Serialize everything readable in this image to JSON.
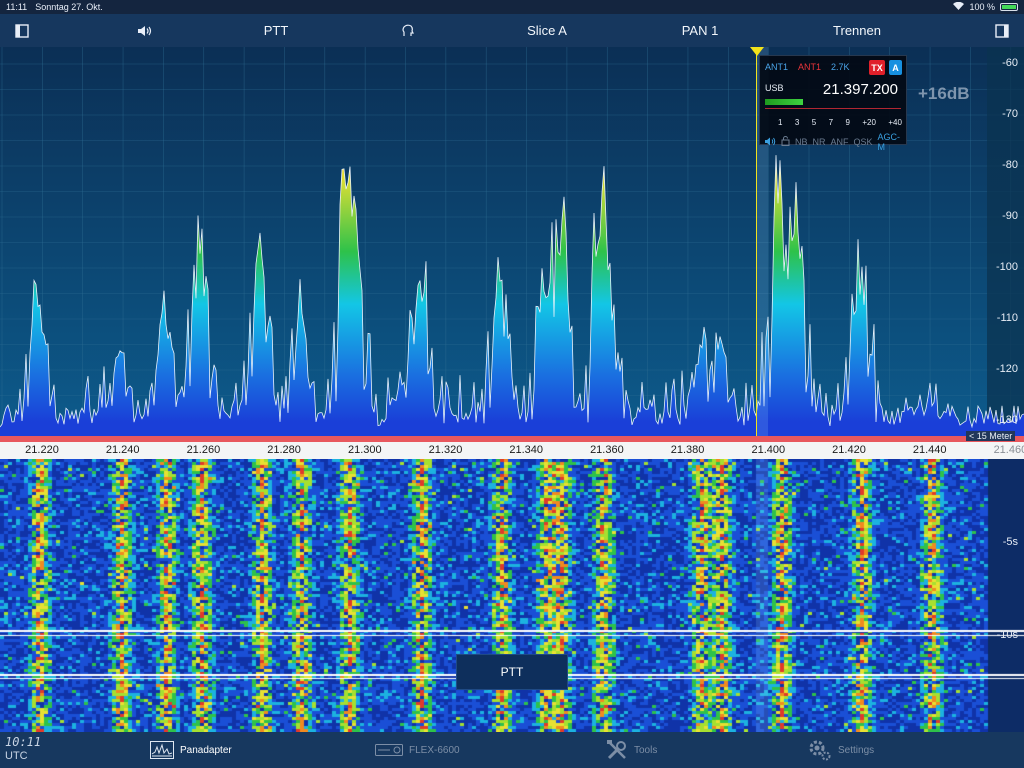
{
  "status_bar": {
    "time": "11:11",
    "date": "Sonntag 27. Okt.",
    "battery": "100 %"
  },
  "toolbar": {
    "volume_icon": "speaker-icon",
    "ptt_label": "PTT",
    "voice_icon": "head-speaking-icon",
    "slice_label": "Slice A",
    "pan_label": "PAN 1",
    "disconnect_label": "Trennen"
  },
  "panadapter": {
    "db_labels": [
      "-60",
      "-70",
      "-80",
      "-90",
      "-100",
      "-110",
      "-120",
      "-130"
    ],
    "gain_label": "+16dB",
    "band_label": "< 15 Meter",
    "freq_labels": [
      "21.220",
      "21.240",
      "21.260",
      "21.280",
      "21.300",
      "21.320",
      "21.340",
      "21.360",
      "21.380",
      "21.400",
      "21.420",
      "21.440",
      "21.460"
    ],
    "colors": {
      "background_top": "#0b2f55",
      "background_bottom": "#0d5b8c",
      "grid": "#2f6f93",
      "spectrum_low": "#1a3fd8",
      "spectrum_mid": "#13c6e6",
      "spectrum_green": "#2ec24a",
      "spectrum_high": "#e8e033",
      "spectrum_peak": "#e03a2a",
      "cursor": "#f3e31a"
    }
  },
  "slice_flag": {
    "antenna_rx": "ANT1",
    "antenna_tx": "ANT1",
    "bandwidth": "2.7K",
    "tx_badge": "TX",
    "slice_letter": "A",
    "mode": "USB",
    "frequency": "21.397.200",
    "smeter_scale": [
      "1",
      "3",
      "5",
      "7",
      "9",
      "+20",
      "+40"
    ],
    "options": [
      "NB",
      "NR",
      "ANF",
      "QSK",
      "AGC-M"
    ]
  },
  "waterfall": {
    "time_labels": [
      "-5s",
      "-10s"
    ]
  },
  "ptt_button_label": "PTT",
  "bottom_bar": {
    "clock_time": "10:11",
    "clock_zone": "UTC",
    "tabs": [
      {
        "label": "Panadapter",
        "icon": "panadapter-icon"
      },
      {
        "label": "FLEX-6600",
        "icon": "radio-icon"
      },
      {
        "label": "Tools",
        "icon": "tools-icon"
      },
      {
        "label": "Settings",
        "icon": "gear-icon"
      }
    ]
  }
}
